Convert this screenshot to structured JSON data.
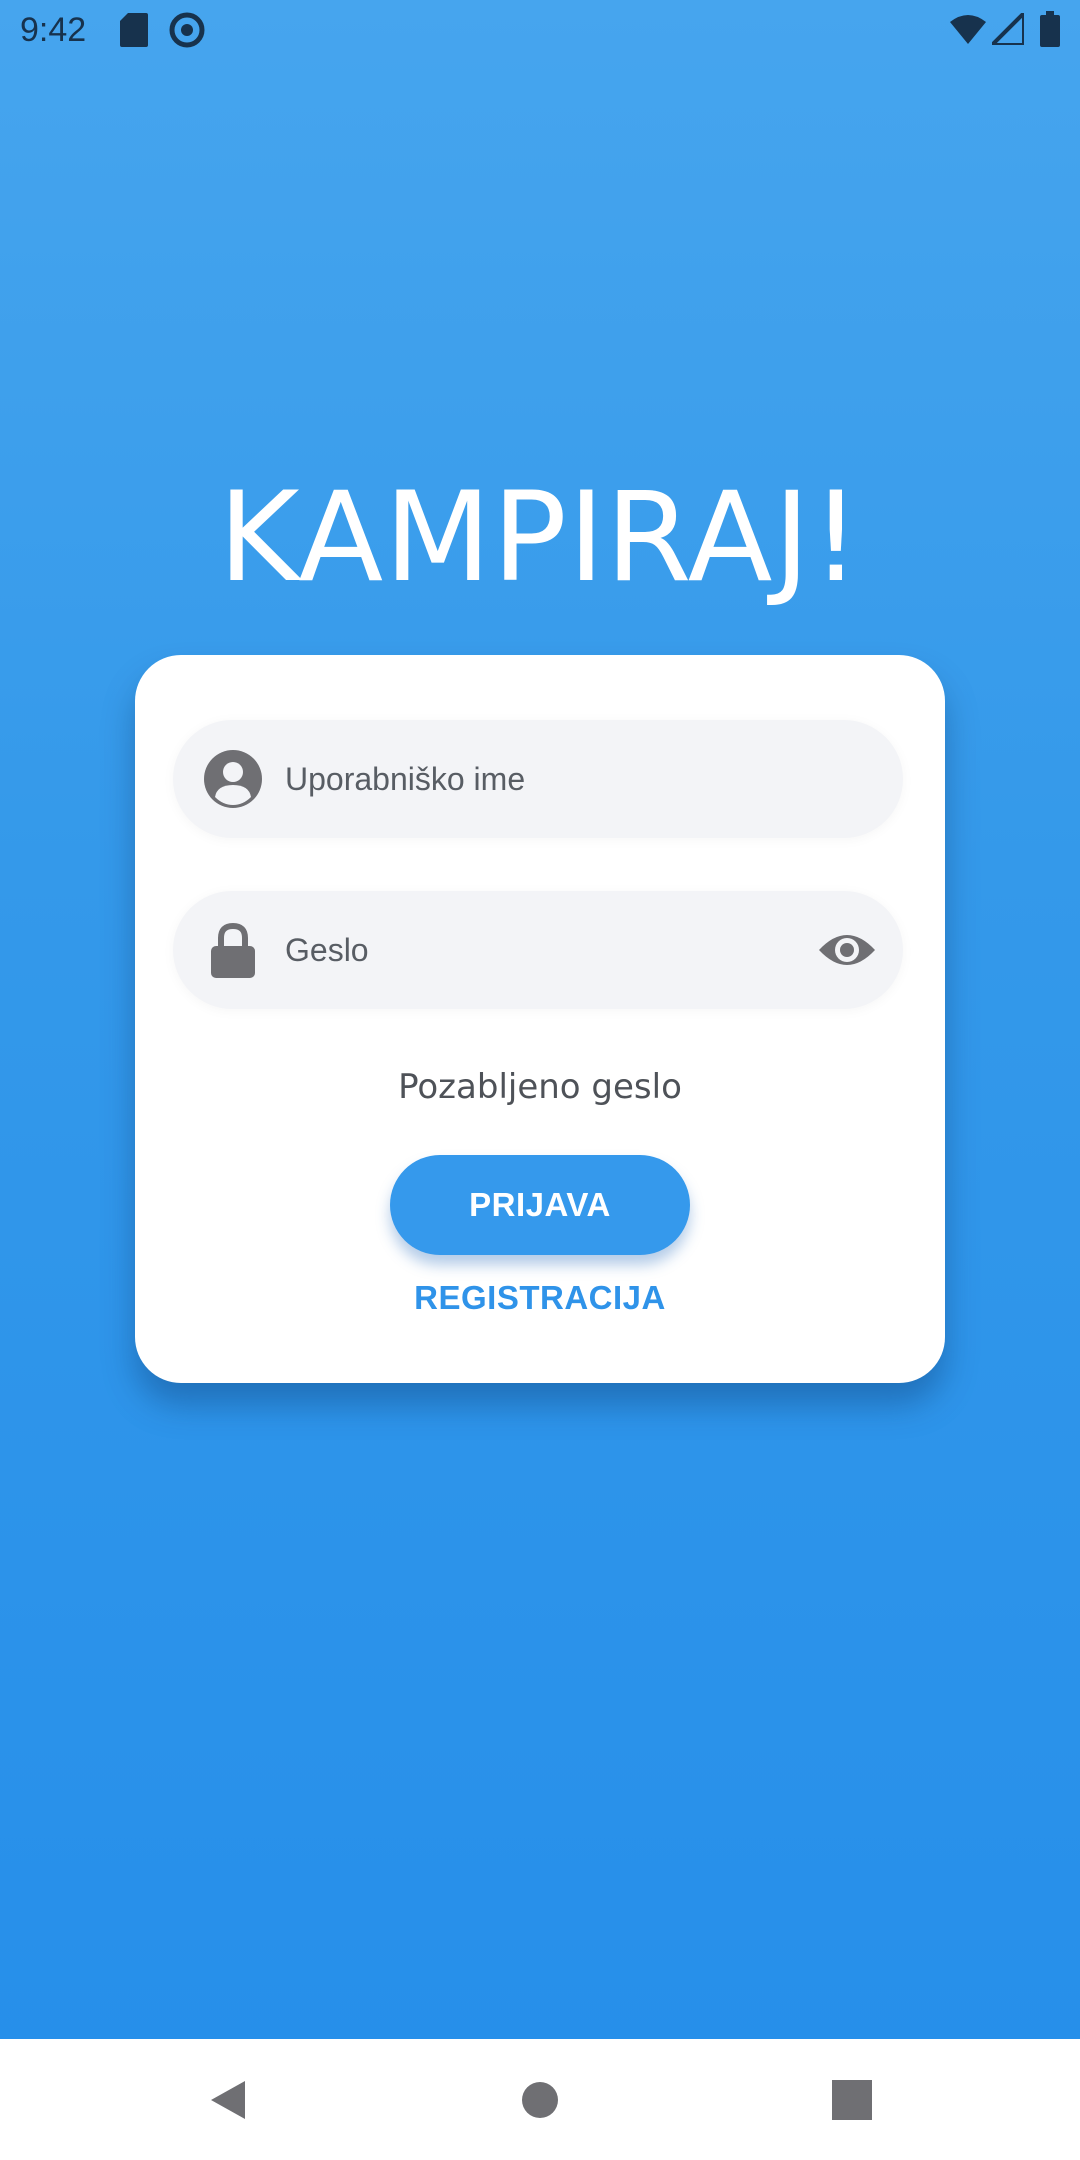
{
  "status_bar": {
    "time": "9:42",
    "icons": [
      "sd-card-icon",
      "sync-icon",
      "wifi-icon",
      "signal-icon",
      "battery-icon"
    ]
  },
  "app": {
    "title": "KAMPIRAJ!"
  },
  "login": {
    "username_placeholder": "Uporabniško ime",
    "password_placeholder": "Geslo",
    "forgot_password_label": "Pozabljeno geslo",
    "login_button_label": "PRIJAVA",
    "register_label": "REGISTRACIJA"
  },
  "nav": {
    "buttons": [
      "back-icon",
      "home-icon",
      "recents-icon"
    ]
  },
  "colors": {
    "background_top": "#46a5ee",
    "background_bottom": "#258eea",
    "primary": "#3599ec",
    "card": "#ffffff",
    "field_bg": "#f3f4f7",
    "icon_gray": "#6f6f73"
  }
}
